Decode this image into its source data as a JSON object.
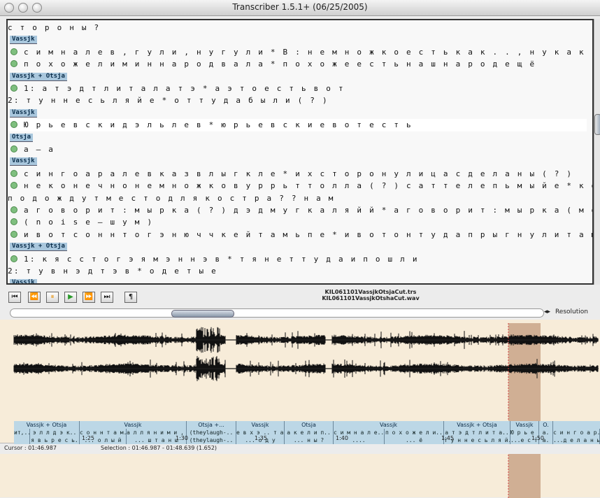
{
  "window": {
    "title": "Transcriber 1.5.1+ (06/25/2005)"
  },
  "editor": {
    "lines": [
      {
        "type": "text",
        "dot": false,
        "text": "  с т о р о н ы ?"
      },
      {
        "type": "speaker",
        "text": "Vassjk"
      },
      {
        "type": "text",
        "dot": true,
        "text": "с и м н а  л е в ,  г у  л и ,  н у  г у  л и  *  В : н е м н о ж к о  е с т ь  к а к . . ,  н у  к а к . ."
      },
      {
        "type": "text",
        "dot": true,
        "text": "п о х о ж е  л и  м и н  н а р о д  в а л а  *  п о х о ж е  е с т ь  н а ш  н а р о д  е щ ё"
      },
      {
        "type": "speaker",
        "text": "Vassjk + Otsja"
      },
      {
        "type": "text",
        "dot": true,
        "text": "1: а  т э д т  л и  т а л а т э  *  а  э т о  е с т ь  в о т"
      },
      {
        "type": "text",
        "dot": false,
        "text": "  2: т у н н е с ь  л я й е  *  о т т у д а  б ы л и ( ? )"
      },
      {
        "type": "speaker",
        "text": "Vassjk"
      },
      {
        "type": "text",
        "dot": true,
        "highlight": true,
        "text": "Ю р ь е в с к и  д э л ь  л е в  *  ю р ь е в с к и е  в о т  е с т ь"
      },
      {
        "type": "speaker",
        "text": "Otsja"
      },
      {
        "type": "text",
        "dot": true,
        "text": "а – а"
      },
      {
        "type": "speaker",
        "text": "Vassjk"
      },
      {
        "type": "text",
        "dot": true,
        "text": "с и н  г о а р а  л е в  к а з в  л ы г к  л е  *  и х  с т о р о н у  л и ц а  с д е л а н ы ( ? )"
      },
      {
        "type": "text",
        "dot": true,
        "text": "н е  к о н е ч н о  н е м н о ж к о  в у р р ь т  т о л л а ( ? )  с а т т е  л е п ь  м ы й е  *  к о н е ч н о  н е м н о ж к о"
      },
      {
        "type": "text",
        "dot": false,
        "text": "  п о д о ж д у т  м е с т о  д л я  к о с т р а  ? ?  н а м"
      },
      {
        "type": "text",
        "dot": true,
        "text": "а  г о в о р и т :  м ы р к а ( ? )  д э д  м у г к а  л я й й  *  а  г о в о р и т :  м ы р к а ( м о р д а )  т а к а я  б ы л а"
      },
      {
        "type": "text",
        "dot": true,
        "text": "( n o i s e  –  ш у м )"
      },
      {
        "type": "text",
        "dot": true,
        "text": "и  в о т  с о н н  т о г э  н ю ч ч к е й  т а м ь п е  *  и  в о т  о н  т у д а  п р ы г н у л  и  т а м"
      },
      {
        "type": "speaker",
        "text": "Vassjk + Otsja"
      },
      {
        "type": "text",
        "dot": true,
        "text": "1: к я с с  т о г э  я  м э н н э в  *  т я н е т  т у д а  и  п о ш л и"
      },
      {
        "type": "text",
        "dot": false,
        "text": "  2: т у в н э д т э в  *  о д е т ы е"
      },
      {
        "type": "speaker",
        "text": "Vassjk"
      }
    ]
  },
  "controls": {
    "buttons": [
      {
        "name": "rewind-start-button",
        "glyph": "⏮"
      },
      {
        "name": "rewind-button",
        "glyph": "⏪"
      },
      {
        "name": "pause-button",
        "glyph": "⏸"
      },
      {
        "name": "play-button",
        "glyph": "▶"
      },
      {
        "name": "forward-button",
        "glyph": "⏩"
      },
      {
        "name": "forward-end-button",
        "glyph": "⏭"
      },
      {
        "name": "paragraph-button",
        "glyph": "¶"
      }
    ],
    "files": [
      "KIL061101VassjkOtsjaCut.trs",
      "KIL061101VassjkOtshaCut.wav"
    ],
    "resolution_label": "Resolution"
  },
  "timeline": {
    "speakers": [
      {
        "label": "Vassjk + Otsja"
      },
      {
        "label": "Vassjk"
      },
      {
        "label": "Otsja +..."
      },
      {
        "label": "Vassjk"
      },
      {
        "label": "Otsja"
      },
      {
        "label": "Vassjk"
      },
      {
        "label": "Vassjk + Otsja"
      },
      {
        "label": "Vassjk"
      },
      {
        "label": "O."
      }
    ],
    "cells": [
      {
        "l1": "ит,..",
        "l2": ""
      },
      {
        "l1": "э л л д э к..",
        "l2": "я в ь р е с ь."
      },
      {
        "l1": "с о н н т а м..",
        "l2": "... о л ы й"
      },
      {
        "l1": "а л л я н и м и , х..",
        "l2": "... ш т а н ы"
      },
      {
        "l1": "(theylaugh-..",
        "l2": "(theylaugh-.."
      },
      {
        "l1": "е в х э .. т а..",
        "l2": "... о д у"
      },
      {
        "l1": "а к е л и п..",
        "l2": "... н ы ?"
      },
      {
        "l1": "с и м н а л е..",
        "l2": "...."
      },
      {
        "l1": "п о х о ж е л и..",
        "l2": "... ё"
      },
      {
        "l1": "а т э д т л и т а..",
        "l2": "т у н н е с ь л я й.."
      },
      {
        "l1": "Ю р ь е ..",
        "l2": "...е с т ь"
      },
      {
        "l1": "а.",
        "l2": "а."
      },
      {
        "l1": "с и н г о а р..",
        "l2": "...д е л а н ы(?)"
      }
    ],
    "ticks": [
      "1:25",
      "1:30",
      "1:35",
      "1:40",
      "1:45",
      "1:50"
    ]
  },
  "status": {
    "cursor": "Cursor : 01:46.987",
    "selection": "Selection : 01:46.987 - 01:48.639 (1.652)"
  },
  "colors": {
    "segment_bar": "#bcd7e6",
    "selection": "#c8a487",
    "cursor_line": "#d04040",
    "waveform_bg": "#f7ecd9",
    "red_band": "#e27f7f"
  }
}
